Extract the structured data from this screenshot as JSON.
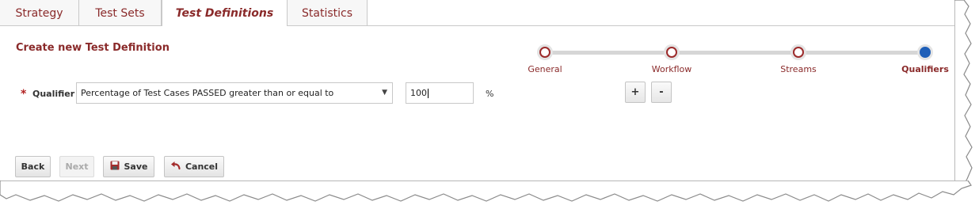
{
  "tabs": [
    {
      "label": "Strategy",
      "active": false
    },
    {
      "label": "Test Sets",
      "active": false
    },
    {
      "label": "Test Definitions",
      "active": true
    },
    {
      "label": "Statistics",
      "active": false
    }
  ],
  "page_title": "Create new Test Definition",
  "wizard": {
    "steps": [
      {
        "label": "General",
        "state": "visited"
      },
      {
        "label": "Workflow",
        "state": "visited"
      },
      {
        "label": "Streams",
        "state": "visited"
      },
      {
        "label": "Qualifiers",
        "state": "current"
      }
    ]
  },
  "qualifier": {
    "required_mark": "*",
    "label": "Qualifier",
    "selected_option": "Percentage of Test Cases PASSED greater than or equal to",
    "value": "100",
    "unit": "%",
    "add_label": "+",
    "remove_label": "-"
  },
  "buttons": {
    "back": "Back",
    "next": "Next",
    "save": "Save",
    "cancel": "Cancel"
  },
  "colors": {
    "accent": "#8a2a2a",
    "current_step": "#1f5fb8",
    "required": "#b22222"
  },
  "icons": {
    "dropdown": "chevron-down-icon",
    "save": "floppy-disk-icon",
    "cancel": "undo-arrow-icon"
  }
}
